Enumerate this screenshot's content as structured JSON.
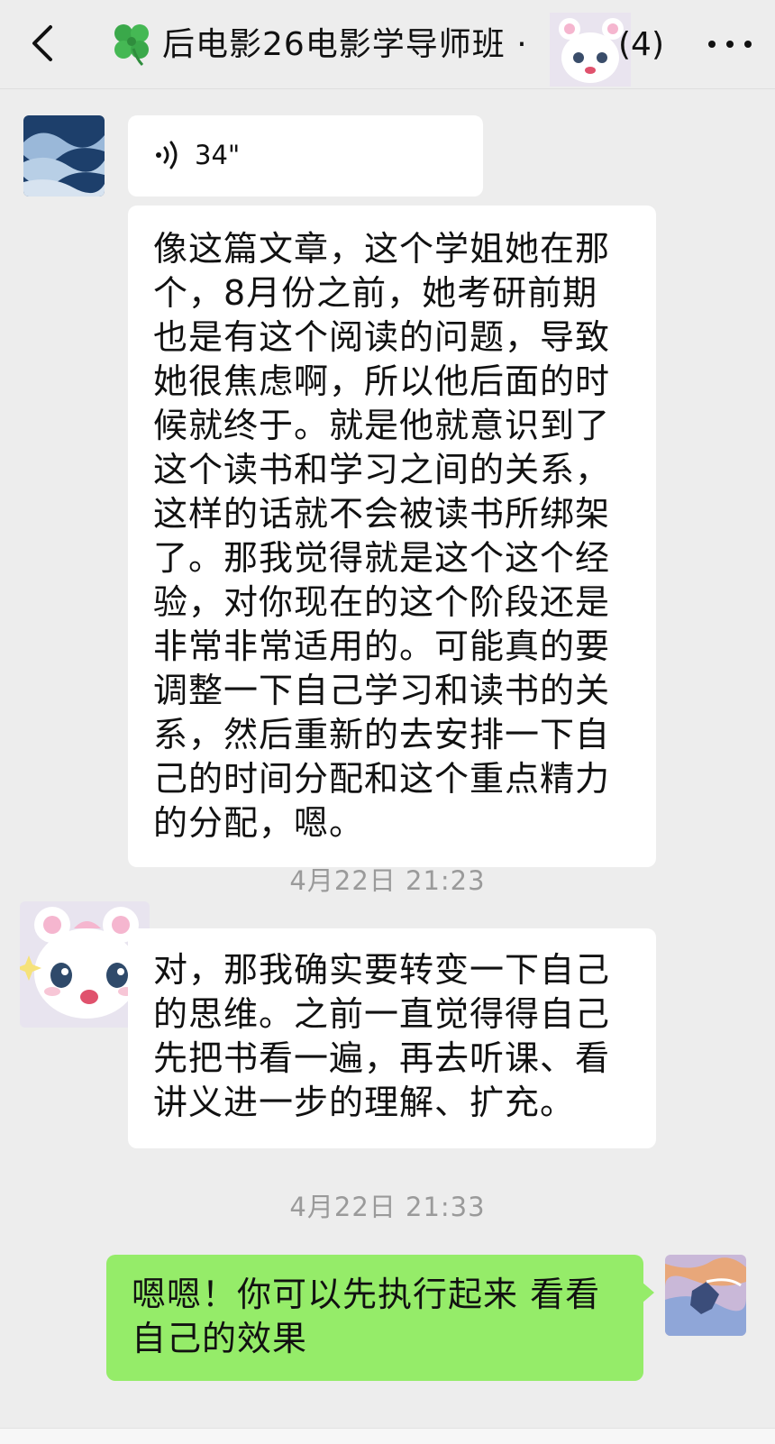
{
  "header": {
    "title": "后电影26电影学导师班 ·",
    "member_count": "(4)"
  },
  "messages": [
    {
      "type": "voice",
      "sender": "left",
      "duration": "34\""
    },
    {
      "type": "text",
      "sender": "left",
      "text": "像这篇文章，这个学姐她在那个，8月份之前，她考研前期也是有这个阅读的问题，导致她很焦虑啊，所以他后面的时候就终于。就是他就意识到了这个读书和学习之间的关系，这样的话就不会被读书所绑架了。那我觉得就是这个这个经验，对你现在的这个阶段还是非常非常适用的。可能真的要调整一下自己学习和读书的关系，然后重新的去安排一下自己的时间分配和这个重点精力的分配，嗯。"
    },
    {
      "type": "timestamp",
      "text": "4月22日 21:23"
    },
    {
      "type": "text",
      "sender": "left",
      "text": "对，那我确实要转变一下自己的思维。之前一直觉得得自己先把书看一遍，再去听课、看讲义进一步的理解、扩充。"
    },
    {
      "type": "timestamp",
      "text": "4月22日 21:33"
    },
    {
      "type": "text",
      "sender": "right",
      "text": "嗯嗯！你可以先执行起来 看看自己的效果"
    }
  ],
  "colors": {
    "background": "#ededed",
    "bubble_left": "#ffffff",
    "bubble_right": "#95ec69",
    "timestamp": "#9a9a9a"
  },
  "icons": [
    "back-arrow-icon",
    "clover-icon",
    "more-dots-icon",
    "voice-wave-icon"
  ]
}
